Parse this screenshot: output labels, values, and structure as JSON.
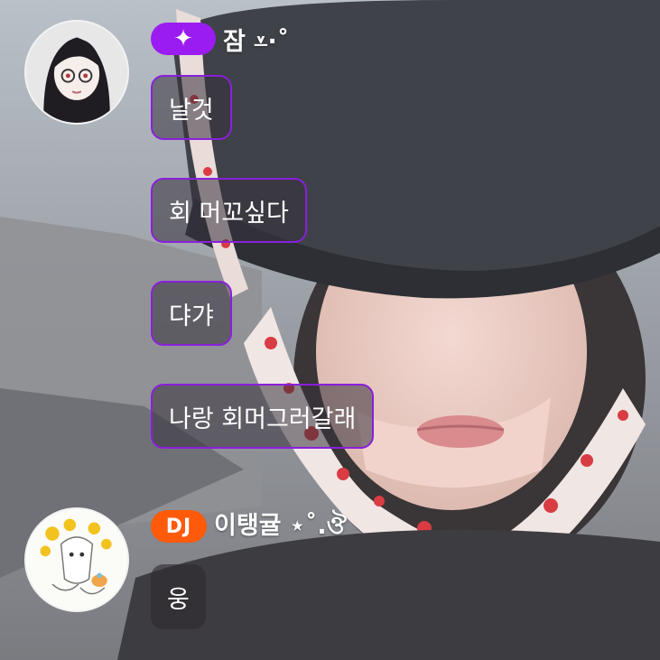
{
  "messages": [
    {
      "badge": "✦",
      "username": "잠 ⩡·˚",
      "lines": [
        "날것",
        "회 머꼬싶다",
        "댜갸",
        "나랑 회머그러갈래"
      ]
    },
    {
      "badge": "DJ",
      "username": "이탱귤 ⋆˚.ঔ",
      "lines": [
        "웅"
      ]
    }
  ],
  "colors": {
    "fan_badge": "#9b1cf0",
    "dj_badge": "#ff5a0a",
    "bubble_border": "#8a1fdb"
  }
}
